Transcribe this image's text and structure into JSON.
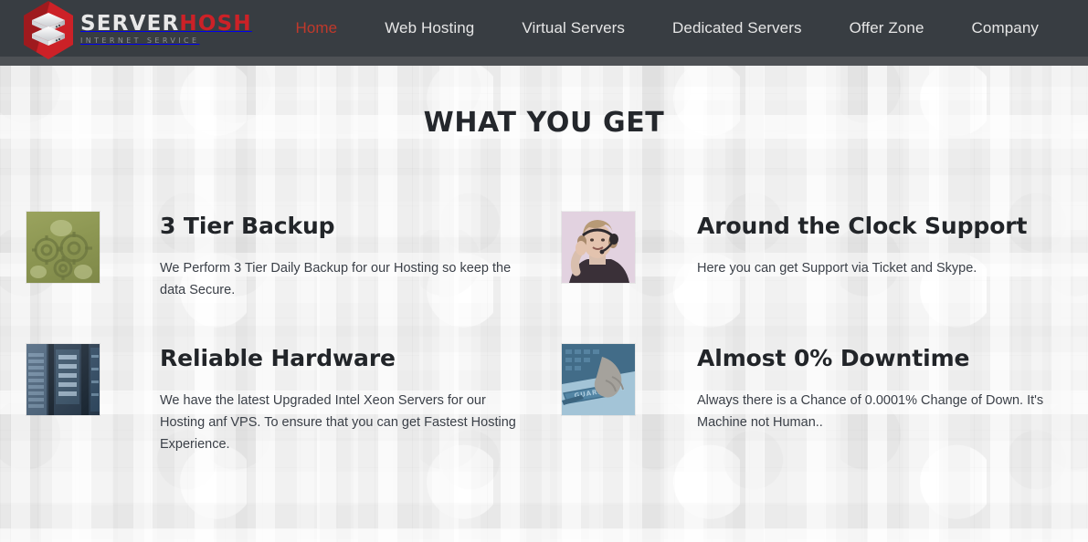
{
  "header": {
    "logo": {
      "icon": "server-stack-hexagon-logo",
      "word_primary": "SERVER",
      "word_accent": "HOSH",
      "tagline": "INTERNET SERVICE",
      "accent_color": "#cc2127",
      "primary_color": "#e8e8e8"
    },
    "background_color": "#383d42",
    "underbar_color": "#4e5155",
    "nav": [
      {
        "label": "Home",
        "active": true
      },
      {
        "label": "Web Hosting",
        "active": false
      },
      {
        "label": "Virtual Servers",
        "active": false
      },
      {
        "label": "Dedicated Servers",
        "active": false
      },
      {
        "label": "Offer Zone",
        "active": false
      },
      {
        "label": "Company",
        "active": false
      }
    ],
    "nav_active_color": "#c0392b",
    "nav_color": "#e6e6e6"
  },
  "main": {
    "section_title": "WHAT YOU GET",
    "section_title_color": "#24272c",
    "background_color": "#f1f1f1",
    "features": [
      {
        "title": "3 Tier Backup",
        "description": "We Perform 3 Tier Daily Backup for our Hosting so keep the data Secure.",
        "image": "gears-machinery-photo",
        "image_tint": "#8d9753"
      },
      {
        "title": "Around the Clock Support",
        "description": "Here you can get Support via Ticket and Skype.",
        "image": "support-agent-headset-photo",
        "image_tint": "#ddc8da"
      },
      {
        "title": "Reliable Hardware",
        "description": "We have the latest Upgraded Intel Xeon Servers for our Hosting anf VPS. To ensure that you can get Fastest Hosting Experience.",
        "image": "server-rack-datacenter-photo",
        "image_tint": "#2b3e52"
      },
      {
        "title": "Almost 0% Downtime",
        "description": "Always there is a Chance of 0.0001% Change of Down. It's Machine not Human..",
        "image": "guarantee-highlighter-photo",
        "image_tint": "#7fb3cf"
      }
    ]
  }
}
